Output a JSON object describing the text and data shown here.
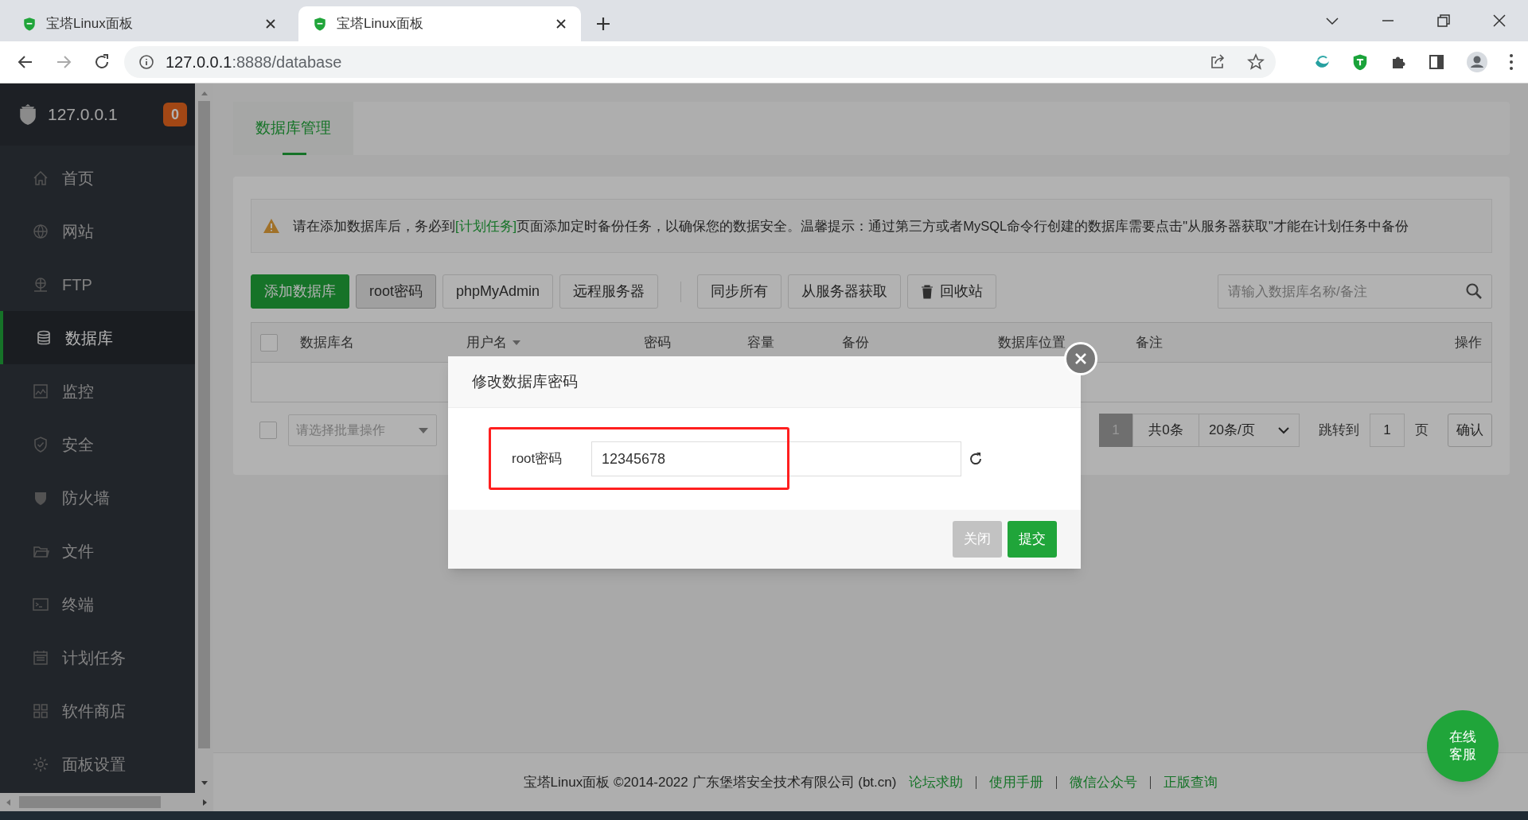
{
  "browser": {
    "tabs": [
      {
        "title": "宝塔Linux面板",
        "selected": false
      },
      {
        "title": "宝塔Linux面板",
        "selected": true
      }
    ],
    "url": {
      "host": "127.0.0.1",
      "path": ":8888/database"
    }
  },
  "sidebar": {
    "host": "127.0.0.1",
    "badge": "0",
    "items": [
      {
        "label": "首页",
        "selected": false
      },
      {
        "label": "网站",
        "selected": false
      },
      {
        "label": "FTP",
        "selected": false
      },
      {
        "label": "数据库",
        "selected": true
      },
      {
        "label": "监控",
        "selected": false
      },
      {
        "label": "安全",
        "selected": false
      },
      {
        "label": "防火墙",
        "selected": false
      },
      {
        "label": "文件",
        "selected": false
      },
      {
        "label": "终端",
        "selected": false
      },
      {
        "label": "计划任务",
        "selected": false
      },
      {
        "label": "软件商店",
        "selected": false
      },
      {
        "label": "面板设置",
        "selected": false
      }
    ]
  },
  "page_tabs": [
    {
      "label": "数据库管理",
      "selected": true
    }
  ],
  "alert": {
    "before": "请在添加数据库后，务必到",
    "link": "[计划任务]",
    "after": "页面添加定时备份任务，以确保您的数据安全。温馨提示：通过第三方或者MySQL命令行创建的数据库需要点击\"从服务器获取\"才能在计划任务中备份"
  },
  "toolbar": {
    "groups": [
      [
        {
          "label": "添加数据库",
          "kind": "primary"
        },
        {
          "label": "root密码",
          "kind": "active"
        },
        {
          "label": "phpMyAdmin",
          "kind": "default"
        },
        {
          "label": "远程服务器",
          "kind": "default"
        }
      ],
      [
        {
          "label": "同步所有",
          "kind": "default"
        },
        {
          "label": "从服务器获取",
          "kind": "default"
        },
        {
          "label": "回收站",
          "kind": "trash"
        }
      ]
    ],
    "search": {
      "placeholder": "请输入数据库名称/备注"
    }
  },
  "table": {
    "select_all": {
      "checked": false
    },
    "columns": [
      {
        "label": "数据库名",
        "sortable": false
      },
      {
        "label": "用户名",
        "sortable": true
      },
      {
        "label": "密码",
        "sortable": false
      },
      {
        "label": "容量",
        "sortable": false
      },
      {
        "label": "备份",
        "sortable": false
      },
      {
        "label": "数据库位置",
        "sortable": false
      },
      {
        "label": "备注",
        "sortable": false
      },
      {
        "label": "操作",
        "sortable": false
      }
    ]
  },
  "batch": {
    "checked": false,
    "placeholder": "请选择批量操作"
  },
  "pagination": {
    "current": "1",
    "total": "共0条",
    "per_page": "20条/页",
    "jump_label": "跳转到",
    "jump_value": "1",
    "page_unit": "页",
    "confirm": "确认"
  },
  "modal": {
    "title": "修改数据库密码",
    "field_label": "root密码",
    "value": "12345678",
    "highlighted": true,
    "buttons": [
      {
        "label": "关闭",
        "kind": "close"
      },
      {
        "label": "提交",
        "kind": "submit"
      }
    ]
  },
  "footer": {
    "text": "宝塔Linux面板 ©2014-2022 广东堡塔安全技术有限公司 (bt.cn)",
    "links": [
      "论坛求助",
      "使用手册",
      "微信公众号",
      "正版查询"
    ]
  },
  "chat": {
    "lines": [
      "在线",
      "客服"
    ]
  }
}
